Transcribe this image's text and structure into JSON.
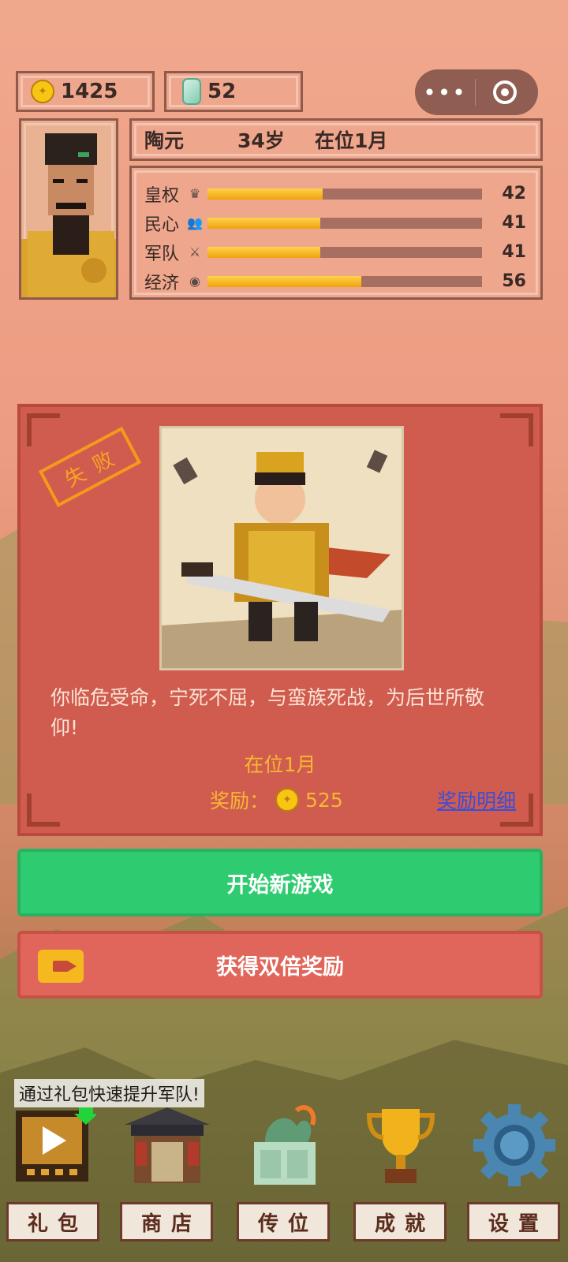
{
  "resources": {
    "gold": "1425",
    "jade": "52"
  },
  "player": {
    "name": "陶元",
    "age": "34岁",
    "reign": "在位1月"
  },
  "stats": [
    {
      "label": "皇权",
      "icon": "crown-icon",
      "value": "42",
      "fill_pct": 42
    },
    {
      "label": "民心",
      "icon": "people-icon",
      "value": "41",
      "fill_pct": 41
    },
    {
      "label": "军队",
      "icon": "swords-icon",
      "value": "41",
      "fill_pct": 41
    },
    {
      "label": "经济",
      "icon": "coins-icon",
      "value": "56",
      "fill_pct": 56
    }
  ],
  "result": {
    "stamp": "失败",
    "description": "你临危受命，宁死不屈，与蛮族死战，为后世所敬仰!",
    "reign": "在位1月",
    "reward_label": "奖励：",
    "reward_value": "525",
    "detail_link": "奖励明细"
  },
  "buttons": {
    "new_game": "开始新游戏",
    "double_reward": "获得双倍奖励"
  },
  "tip": "通过礼包快速提升军队!",
  "nav": [
    {
      "label": "礼包",
      "icon": "video-gift-icon"
    },
    {
      "label": "商店",
      "icon": "shop-icon"
    },
    {
      "label": "传位",
      "icon": "jade-seal-icon"
    },
    {
      "label": "成就",
      "icon": "trophy-icon"
    },
    {
      "label": "设置",
      "icon": "gear-icon"
    }
  ],
  "colors": {
    "accent_green": "#2fcb70",
    "accent_red": "#e0665b",
    "card": "#cf5c4e",
    "gold": "#f7b733"
  }
}
